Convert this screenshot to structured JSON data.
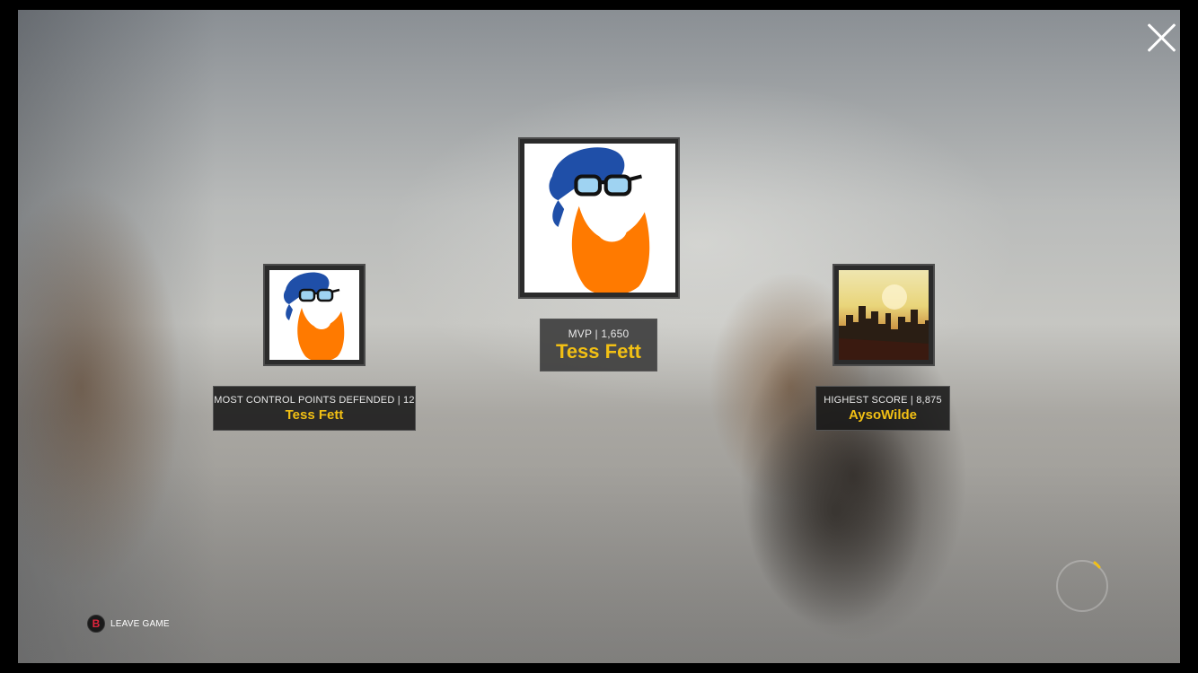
{
  "window": {
    "close_label": ""
  },
  "mvp": {
    "stat": "MVP | 1,650",
    "name": "Tess Fett",
    "avatar_icon": "bearded-man-cap-glasses-icon"
  },
  "awards": [
    {
      "stat": "MOST CONTROL POINTS DEFENDED | 12",
      "name": "Tess Fett",
      "avatar_icon": "bearded-man-cap-glasses-icon"
    },
    {
      "stat": "HIGHEST SCORE | 8,875",
      "name": "AysoWilde",
      "avatar_icon": "city-skyline-sunset-icon"
    }
  ],
  "footer": {
    "leave_button_glyph": "B",
    "leave_label": "LEAVE GAME"
  },
  "loading": {
    "progress": 0.05
  },
  "colors": {
    "accent_name": "#f2c014",
    "b_button": "#e0243c",
    "beard": "#ff7a00",
    "cap": "#1f4fa8"
  }
}
